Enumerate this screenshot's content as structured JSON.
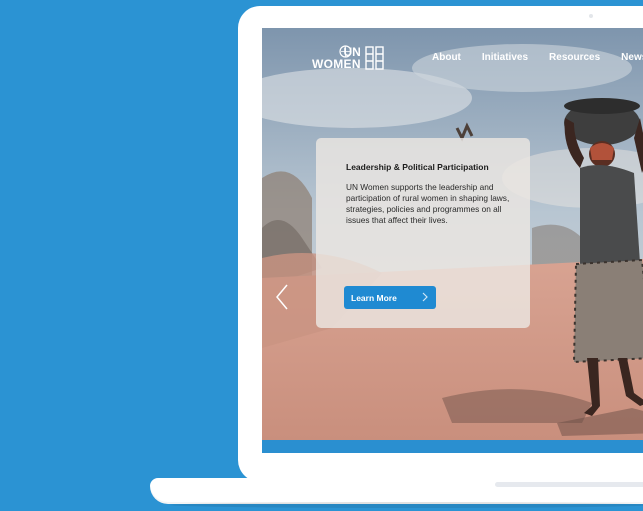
{
  "brand": {
    "logo_line1": "UN",
    "logo_line2": "WOMEN"
  },
  "nav": {
    "items": [
      {
        "label": "About"
      },
      {
        "label": "Initiatives"
      },
      {
        "label": "Resources"
      },
      {
        "label": "News"
      }
    ]
  },
  "hero": {
    "title": "Leadership & Political Participation",
    "body": "UN Women supports the leadership and participation of rural women in shaping laws, strategies, policies and programmes on all issues that affect their lives.",
    "button_label": "Learn More"
  },
  "colors": {
    "background": "#2b93d3",
    "accent": "#1f8ad2",
    "card": "#ece6e2"
  },
  "icons": {
    "logo": "un-emblem-icon",
    "prev": "chevron-left-icon",
    "button": "chevron-right-icon"
  }
}
